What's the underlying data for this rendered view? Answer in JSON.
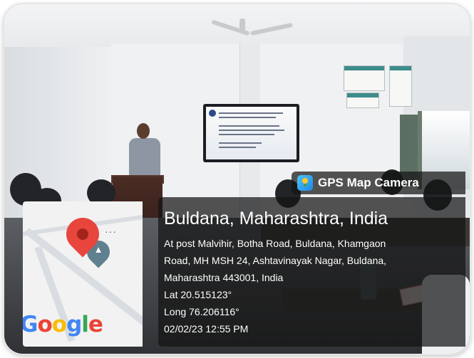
{
  "badge": {
    "label": "GPS Map Camera",
    "icon": "gps-map-camera-icon"
  },
  "location": {
    "place": "Buldana, Maharashtra, India",
    "address_lines": [
      "At post Malvihir, Botha Road, Buldana, Khamgaon",
      "Road, MH MSH 24, Ashtavinayak Nagar, Buldana,",
      "Maharashtra 443001, India"
    ],
    "lat": "Lat 20.515123°",
    "long": "Long 76.206116°",
    "datetime": "02/02/23 12:55 PM"
  },
  "map": {
    "logo": [
      "G",
      "o",
      "o",
      "g",
      "l",
      "e"
    ],
    "logo_colors": [
      "#4285F4",
      "#EA4335",
      "#FBBC05",
      "#4285F4",
      "#34A853",
      "#EA4335"
    ],
    "more_label": "···"
  }
}
